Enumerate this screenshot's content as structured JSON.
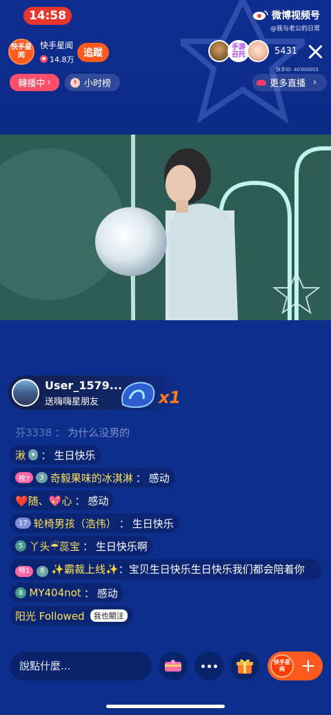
{
  "status": {
    "time": "14:58"
  },
  "watermark": {
    "title": "微博视频号",
    "sub": "@我与老公的日常"
  },
  "host": {
    "avatar_text": "快手星闻",
    "name": "快手星闻",
    "likes": "14.8万",
    "follow_label": "追蹤"
  },
  "viewers": {
    "badge_text": "手游召托",
    "count": "5431",
    "id_text": "快手ID: 40300003"
  },
  "pills": {
    "relay": "轉播中",
    "rank": "小时榜",
    "more": "更多直播"
  },
  "gift": {
    "user": "User_1579...",
    "desc": "送嗨嗨星朋友",
    "count": "x1"
  },
  "chat": [
    {
      "name": "芬3338",
      "msg": "为什么没男的"
    },
    {
      "name": "湫",
      "msg": "生日快乐"
    },
    {
      "badges": [
        "榜7",
        "3"
      ],
      "name": "奇毅果味的冰淇淋",
      "msg": "感动"
    },
    {
      "name": "❤️随、💖心",
      "msg": "感动"
    },
    {
      "badges": [
        "17"
      ],
      "name": "轮椅男孩（浩伟）",
      "msg": "生日快乐"
    },
    {
      "badges": [
        "5"
      ],
      "name": "丫头☔蕊宝",
      "msg": "生日快乐啊"
    },
    {
      "badges": [
        "榜1",
        "8"
      ],
      "name": "✨霸裁上线✨",
      "msg": "宝贝生日快乐生日快乐我们都会陪着你"
    },
    {
      "badges": [
        "8"
      ],
      "name": "MY404not",
      "msg": "感动"
    },
    {
      "name": "阳光 Followed",
      "tag": "我也關注"
    }
  ],
  "bottom": {
    "placeholder": "說點什麼...",
    "logo_text": "快手星闻",
    "plus": "+"
  },
  "colors": {
    "background": "#0e2e8c",
    "accent": "#ff5a1f",
    "live_pill": "#ff4f6a",
    "username": "#ffe25a"
  }
}
